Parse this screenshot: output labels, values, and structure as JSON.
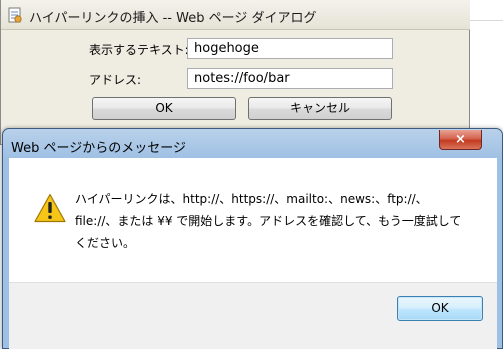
{
  "dialog_hyperlink": {
    "title": "ハイパーリンクの挿入 -- Web ページ ダイアログ",
    "display_text_label": "表示するテキスト:",
    "display_text_value": "hogehoge",
    "address_label": "アドレス:",
    "address_value": "notes://foo/bar",
    "ok_label": "OK",
    "cancel_label": "キャンセル"
  },
  "dialog_message": {
    "title": "Web ページからのメッセージ",
    "close_label": "×",
    "message": "ハイパーリンクは、http://、https://、mailto:、news:、ftp://、file://、または ¥¥ で開始します。アドレスを確認して、もう一度試してください。",
    "ok_label": "OK"
  },
  "colors": {
    "dialog_face": "#efece1",
    "message_frame": "#9ec0e4",
    "close_button": "#c33a20"
  },
  "icons": {
    "dialog_icon": "page-link-icon",
    "message_icon": "warning-icon"
  }
}
